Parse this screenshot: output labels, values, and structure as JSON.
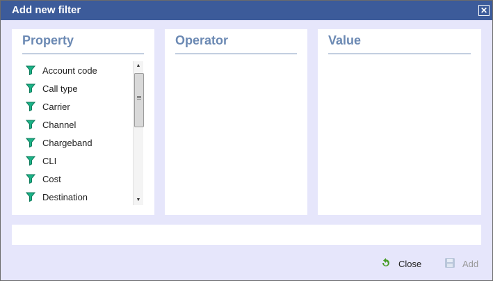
{
  "dialog": {
    "title": "Add new filter",
    "close_glyph": "✕"
  },
  "panels": {
    "property": {
      "header": "Property"
    },
    "operator": {
      "header": "Operator"
    },
    "value": {
      "header": "Value"
    }
  },
  "properties": [
    {
      "label": "Account code",
      "icon": "filter-icon"
    },
    {
      "label": "Call type",
      "icon": "filter-icon"
    },
    {
      "label": "Carrier",
      "icon": "filter-icon"
    },
    {
      "label": "Channel",
      "icon": "filter-icon"
    },
    {
      "label": "Chargeband",
      "icon": "filter-icon"
    },
    {
      "label": "CLI",
      "icon": "filter-icon"
    },
    {
      "label": "Cost",
      "icon": "filter-icon"
    },
    {
      "label": "Destination",
      "icon": "filter-icon"
    }
  ],
  "buttons": {
    "close": {
      "label": "Close",
      "icon": "undo-arrow-icon"
    },
    "add": {
      "label": "Add",
      "icon": "save-disk-icon",
      "disabled": true
    }
  },
  "colors": {
    "titlebar": "#3c5b9a",
    "header_text": "#6b89b3",
    "funnel_green": "#1bb387",
    "dialog_bg": "#e6e6fb"
  }
}
